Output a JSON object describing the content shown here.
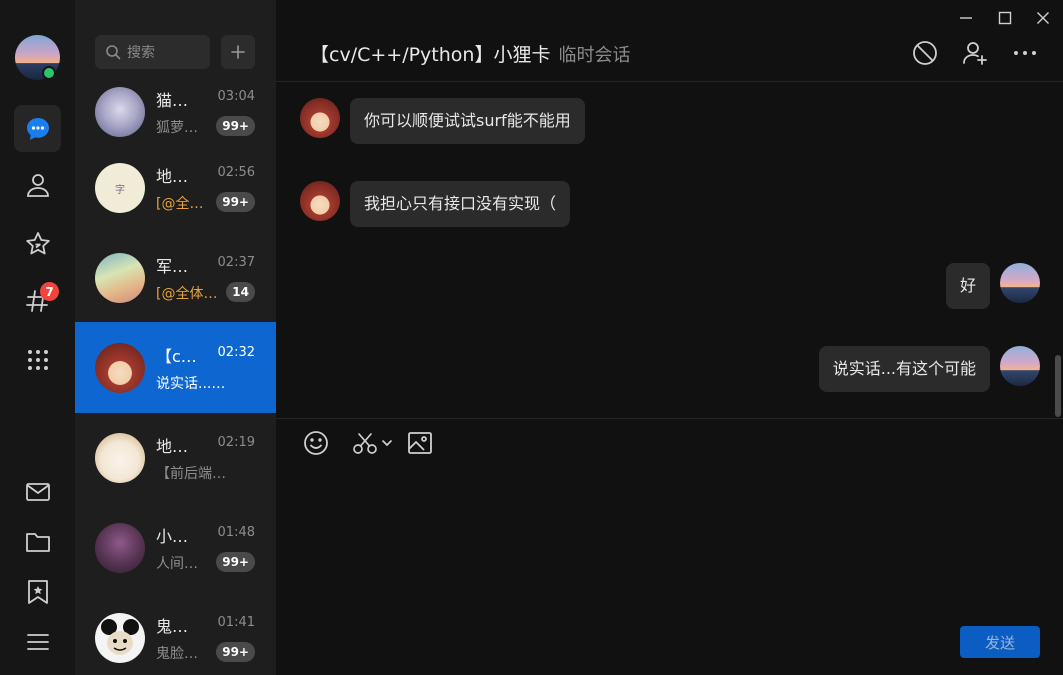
{
  "rail": {
    "badge_count": "7",
    "icons": [
      "chat-icon",
      "contacts-icon",
      "star-icon",
      "channel-icon",
      "apps-icon",
      "mail-icon",
      "folder-icon",
      "bookmark-icon",
      "menu-icon"
    ]
  },
  "search": {
    "placeholder": "搜索"
  },
  "conversations": [
    {
      "name": "猫…",
      "time": "03:04",
      "preview": "狐萝…",
      "count": "99+",
      "mention": false
    },
    {
      "name": "地…",
      "time": "02:56",
      "preview": "[@全…",
      "count": "99+",
      "mention": true
    },
    {
      "name": "军…",
      "time": "02:37",
      "preview": "[@全体…",
      "count": "14",
      "mention": true
    },
    {
      "name": "【c…",
      "time": "02:32",
      "preview": "说实话...…",
      "count": "",
      "mention": false,
      "active": true
    },
    {
      "name": "地…",
      "time": "02:19",
      "preview": "【前后端…",
      "count": "",
      "mention": false
    },
    {
      "name": "小…",
      "time": "01:48",
      "preview": "人间…",
      "count": "99+",
      "mention": false
    },
    {
      "name": "鬼…",
      "time": "01:41",
      "preview": "鬼脸…",
      "count": "99+",
      "mention": false
    }
  ],
  "chat": {
    "title": "【cv/C++/Python】小狸卡",
    "subtitle": "临时会话",
    "messages": [
      {
        "from": "other",
        "text": "你可以顺便试试surf能不能用"
      },
      {
        "from": "other",
        "text": "我担心只有接口没有实现（"
      },
      {
        "from": "me",
        "text": "好"
      },
      {
        "from": "me",
        "text": "说实话...有这个可能"
      }
    ],
    "send_label": "发送"
  },
  "colors": {
    "accent": "#0e67d1",
    "badge": "#f0443c",
    "online": "#2bc56b",
    "mention": "#e8a23a"
  }
}
